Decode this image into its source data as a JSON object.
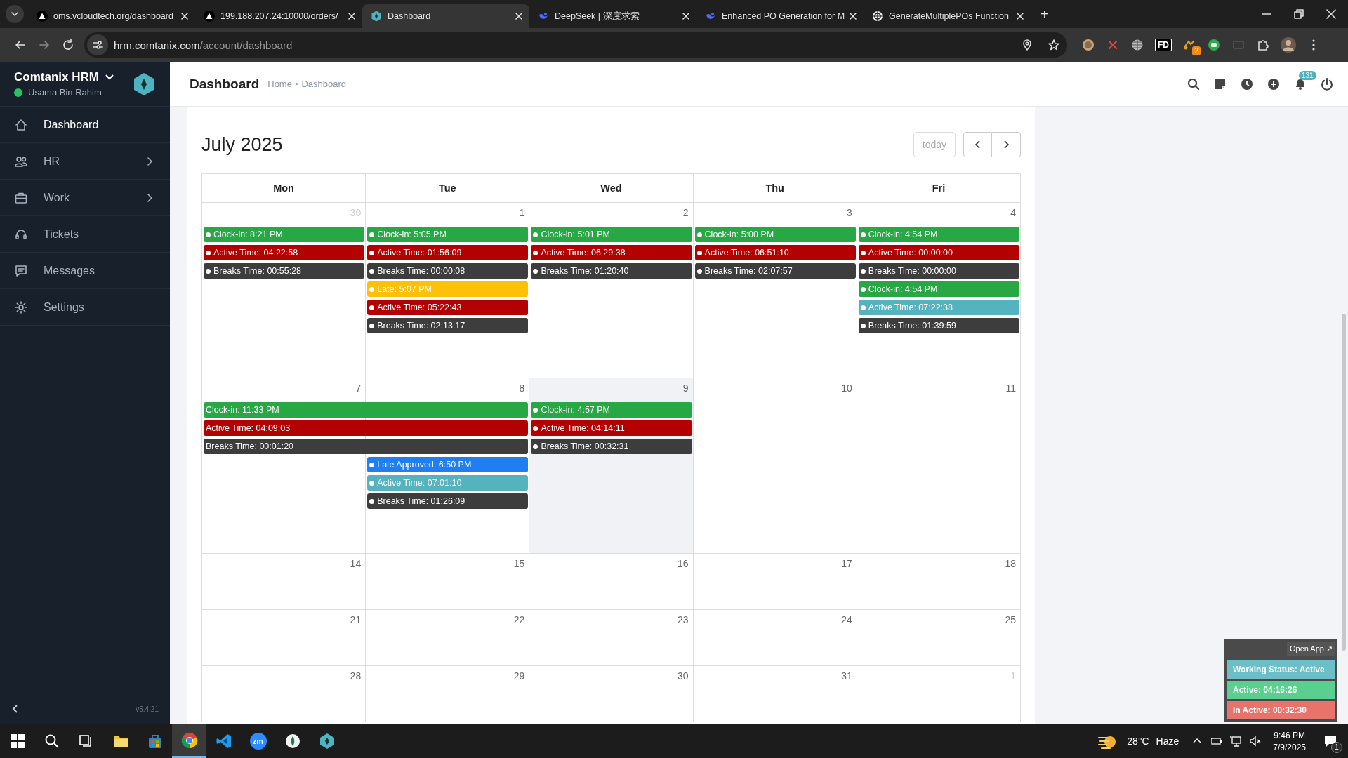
{
  "browser": {
    "tabs": [
      {
        "title": "oms.vcloudtech.org/dashboard",
        "kind": "triangle",
        "selected": false
      },
      {
        "title": "199.188.207.24:10000/orders/",
        "kind": "triangle",
        "selected": false
      },
      {
        "title": "Dashboard",
        "kind": "hexagon",
        "selected": true
      },
      {
        "title": "DeepSeek | 深度求索",
        "kind": "swirl",
        "selected": false
      },
      {
        "title": "Enhanced PO Generation for M",
        "kind": "swirl",
        "selected": false
      },
      {
        "title": "GenerateMultiplePOs Function",
        "kind": "knot",
        "selected": false
      }
    ],
    "new_tab": "+",
    "address": {
      "host": "hrm.comtanix.com",
      "path": "/account/dashboard"
    },
    "extensions": [
      {
        "kind": "circle"
      },
      {
        "kind": "cross"
      },
      {
        "kind": "globe"
      },
      {
        "kind": "label",
        "label": "FD"
      },
      {
        "kind": "badge",
        "badge": "2"
      },
      {
        "kind": "robot"
      },
      {
        "kind": "cast"
      },
      {
        "kind": "puzzle"
      },
      {
        "kind": "avatar"
      }
    ]
  },
  "sidebar": {
    "brand": "Comtanix HRM",
    "user": "Usama Bin Rahim",
    "online": true,
    "items": [
      {
        "label": "Dashboard",
        "kind": "home",
        "selected": true,
        "expandable": false
      },
      {
        "label": "HR",
        "kind": "people",
        "selected": false,
        "expandable": true
      },
      {
        "label": "Work",
        "kind": "briefcase",
        "selected": false,
        "expandable": true
      },
      {
        "label": "Tickets",
        "kind": "headset",
        "selected": false,
        "expandable": false
      },
      {
        "label": "Messages",
        "kind": "chat",
        "selected": false,
        "expandable": false
      },
      {
        "label": "Settings",
        "kind": "gear",
        "selected": false,
        "expandable": false
      }
    ],
    "version": "v5.4.21"
  },
  "header": {
    "title": "Dashboard",
    "breadcrumb": [
      {
        "label": "Home"
      },
      {
        "label": "Dashboard"
      }
    ],
    "separator": "•",
    "icons": [
      {
        "kind": "search"
      },
      {
        "kind": "note"
      },
      {
        "kind": "clock"
      },
      {
        "kind": "plus"
      },
      {
        "kind": "bell",
        "badge": "131"
      },
      {
        "kind": "power"
      }
    ]
  },
  "calendar": {
    "title": "July 2025",
    "today_button": {
      "label": "today",
      "disabled": true
    },
    "columns": [
      "Mon",
      "Tue",
      "Wed",
      "Thu",
      "Fri"
    ],
    "weeks": [
      {
        "days": [
          {
            "number": "30",
            "other_month": true,
            "today": false,
            "events": [
              {
                "label": "Clock-in: 8:21 PM",
                "color": "#28a745",
                "kind": "single"
              },
              {
                "label": "Active Time: 04:22:58",
                "color": "#b30000",
                "kind": "single"
              },
              {
                "label": "Breaks Time: 00:55:28",
                "color": "#3d3d3d",
                "kind": "single"
              }
            ]
          },
          {
            "number": "1",
            "other_month": false,
            "today": false,
            "events": [
              {
                "label": "Clock-in: 5:05 PM",
                "color": "#28a745",
                "kind": "single"
              },
              {
                "label": "Active Time: 01:56:09",
                "color": "#b30000",
                "kind": "single"
              },
              {
                "label": "Breaks Time: 00:00:08",
                "color": "#3d3d3d",
                "kind": "single"
              },
              {
                "label": "Late: 5:07 PM",
                "color": "#ffc107",
                "kind": "single"
              },
              {
                "label": "Active Time: 05:22:43",
                "color": "#b30000",
                "kind": "single"
              },
              {
                "label": "Breaks Time: 02:13:17",
                "color": "#3d3d3d",
                "kind": "single"
              }
            ]
          },
          {
            "number": "2",
            "other_month": false,
            "today": false,
            "events": [
              {
                "label": "Clock-in: 5:01 PM",
                "color": "#28a745",
                "kind": "single"
              },
              {
                "label": "Active Time: 06:29:38",
                "color": "#b30000",
                "kind": "single"
              },
              {
                "label": "Breaks Time: 01:20:40",
                "color": "#3d3d3d",
                "kind": "single"
              }
            ]
          },
          {
            "number": "3",
            "other_month": false,
            "today": false,
            "events": [
              {
                "label": "Clock-in: 5:00 PM",
                "color": "#28a745",
                "kind": "single"
              },
              {
                "label": "Active Time: 06:51:10",
                "color": "#b30000",
                "kind": "single"
              },
              {
                "label": "Breaks Time: 02:07:57",
                "color": "#3d3d3d",
                "kind": "single"
              }
            ]
          },
          {
            "number": "4",
            "other_month": false,
            "today": false,
            "events": [
              {
                "label": "Clock-in: 4:54 PM",
                "color": "#28a745",
                "kind": "single"
              },
              {
                "label": "Active Time: 00:00:00",
                "color": "#b30000",
                "kind": "single"
              },
              {
                "label": "Breaks Time: 00:00:00",
                "color": "#3d3d3d",
                "kind": "single"
              },
              {
                "label": "Clock-in: 4:54 PM",
                "color": "#28a745",
                "kind": "single"
              },
              {
                "label": "Active Time: 07:22:38",
                "color": "#55b3c0",
                "kind": "single"
              },
              {
                "label": "Breaks Time: 01:39:59",
                "color": "#3d3d3d",
                "kind": "single"
              }
            ]
          }
        ]
      },
      {
        "days": [
          {
            "number": "7",
            "other_month": false,
            "today": false,
            "events": [
              {
                "label": "Clock-in: 11:33 PM",
                "color": "#28a745",
                "kind": "multi_day"
              },
              {
                "label": "Active Time: 04:09:03",
                "color": "#b30000",
                "kind": "multi_day"
              },
              {
                "label": "Breaks Time: 00:01:20",
                "color": "#3d3d3d",
                "kind": "multi_day"
              }
            ]
          },
          {
            "number": "8",
            "other_month": false,
            "today": false,
            "events": [
              {
                "label": "Late Approved: 6:50 PM",
                "color": "#1f7ff2",
                "kind": "single"
              },
              {
                "label": "Active Time: 07:01:10",
                "color": "#55b3c0",
                "kind": "single"
              },
              {
                "label": "Breaks Time: 01:26:09",
                "color": "#3d3d3d",
                "kind": "single"
              }
            ]
          },
          {
            "number": "9",
            "other_month": false,
            "today": true,
            "events": [
              {
                "label": "Clock-in: 4:57 PM",
                "color": "#28a745",
                "kind": "single"
              },
              {
                "label": "Active Time: 04:14:11",
                "color": "#b30000",
                "kind": "single"
              },
              {
                "label": "Breaks Time: 00:32:31",
                "color": "#3d3d3d",
                "kind": "single"
              }
            ]
          },
          {
            "number": "10",
            "other_month": false,
            "today": false
          },
          {
            "number": "11",
            "other_month": false,
            "today": false
          }
        ]
      },
      {
        "days": [
          {
            "number": "14",
            "other_month": false,
            "today": false
          },
          {
            "number": "15",
            "other_month": false,
            "today": false
          },
          {
            "number": "16",
            "other_month": false,
            "today": false
          },
          {
            "number": "17",
            "other_month": false,
            "today": false
          },
          {
            "number": "18",
            "other_month": false,
            "today": false
          }
        ]
      },
      {
        "days": [
          {
            "number": "21",
            "other_month": false,
            "today": false
          },
          {
            "number": "22",
            "other_month": false,
            "today": false
          },
          {
            "number": "23",
            "other_month": false,
            "today": false
          },
          {
            "number": "24",
            "other_month": false,
            "today": false
          },
          {
            "number": "25",
            "other_month": false,
            "today": false
          }
        ]
      },
      {
        "days": [
          {
            "number": "28",
            "other_month": false,
            "today": false
          },
          {
            "number": "29",
            "other_month": false,
            "today": false
          },
          {
            "number": "30",
            "other_month": false,
            "today": false
          },
          {
            "number": "31",
            "other_month": false,
            "today": false
          },
          {
            "number": "1",
            "other_month": true,
            "today": false
          }
        ]
      }
    ]
  },
  "status_widget": {
    "open_button": "Open App ↗",
    "rows": [
      {
        "label": "Working Status: Active",
        "color": "#6cbfc9"
      },
      {
        "label": "Active: 04:16:26",
        "color": "#5bcf8f"
      },
      {
        "label": "In Active: 00:32:30",
        "color": "#e8736a"
      }
    ]
  },
  "taskbar": {
    "apps": [
      {
        "kind": "windows",
        "active": false
      },
      {
        "kind": "search",
        "active": false
      },
      {
        "kind": "taskview",
        "active": false
      },
      {
        "kind": "folder",
        "active": false
      },
      {
        "kind": "store",
        "active": false
      },
      {
        "kind": "chrome",
        "active": true
      },
      {
        "kind": "vscode",
        "active": false
      },
      {
        "kind": "zoom",
        "label": "zm",
        "active": false
      },
      {
        "kind": "leaf",
        "active": false
      },
      {
        "kind": "hexagon",
        "active": false
      }
    ],
    "temperature": "28°C",
    "weather": "Haze",
    "time": "9:46 PM",
    "date": "7/9/2025",
    "notifications": "1"
  }
}
